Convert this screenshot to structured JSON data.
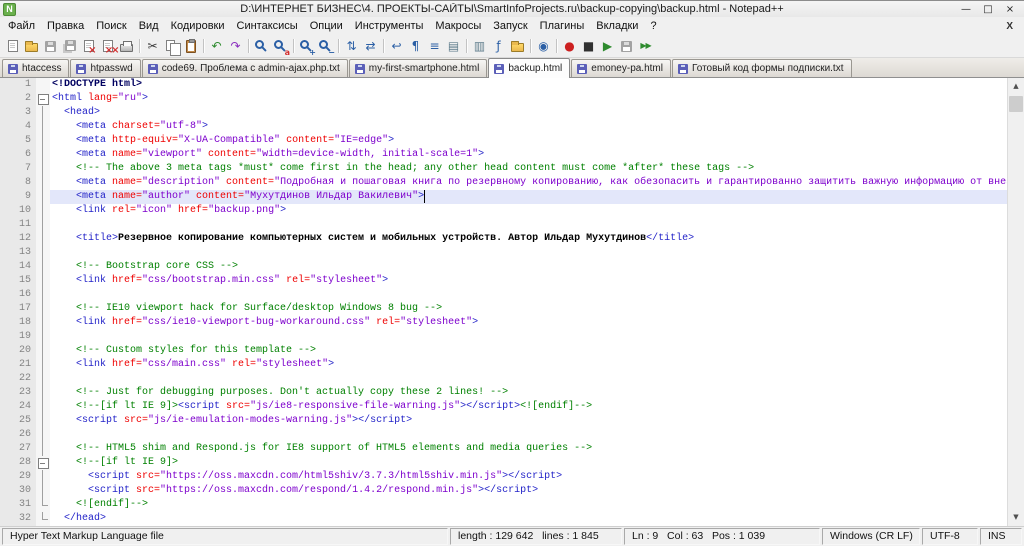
{
  "window": {
    "title": "D:\\ИНТЕРНЕТ БИЗНЕС\\4. ПРОЕКТЫ-САЙТЫ\\SmartInfoProjects.ru\\backup-copying\\backup.html - Notepad++",
    "icon_letter": "N",
    "controls": [
      {
        "name": "minimize-button",
        "glyph": "—"
      },
      {
        "name": "restore-button",
        "glyph": "□"
      },
      {
        "name": "close-button",
        "glyph": "×"
      }
    ]
  },
  "menu": {
    "items": [
      "Файл",
      "Правка",
      "Поиск",
      "Вид",
      "Кодировки",
      "Синтаксисы",
      "Опции",
      "Инструменты",
      "Макросы",
      "Запуск",
      "Плагины",
      "Вкладки",
      "?"
    ],
    "close_label": "X"
  },
  "toolbar": {
    "items": [
      {
        "name": "new-file-icon",
        "type": "sheet"
      },
      {
        "name": "open-file-icon",
        "type": "folder"
      },
      {
        "name": "save-icon",
        "type": "floppy",
        "dim": true
      },
      {
        "name": "save-all-icon",
        "type": "floppy2",
        "dim": true
      },
      {
        "name": "close-icon",
        "type": "sheet-x"
      },
      {
        "name": "close-all-icon",
        "type": "sheet-xx"
      },
      {
        "name": "print-icon",
        "type": "printer"
      },
      {
        "sep": true
      },
      {
        "name": "cut-icon",
        "type": "glyph",
        "glyph": "✂",
        "color": "#3a3a3a"
      },
      {
        "name": "copy-icon",
        "type": "pages"
      },
      {
        "name": "paste-icon",
        "type": "clipboard"
      },
      {
        "sep": true
      },
      {
        "name": "undo-icon",
        "type": "glyph",
        "glyph": "↶",
        "color": "#2e8b2e"
      },
      {
        "name": "redo-icon",
        "type": "glyph",
        "glyph": "↷",
        "color": "#8a2ebe"
      },
      {
        "sep": true
      },
      {
        "name": "find-icon",
        "type": "mag"
      },
      {
        "name": "replace-icon",
        "type": "mag",
        "badge": "a",
        "badge_color": "#d32f2f"
      },
      {
        "sep": true
      },
      {
        "name": "zoom-in-icon",
        "type": "mag",
        "badge": "+",
        "badge_color": "#2b5fa5"
      },
      {
        "name": "zoom-out-icon",
        "type": "mag",
        "badge": "−",
        "badge_color": "#2b5fa5"
      },
      {
        "sep": true
      },
      {
        "name": "sync-vertical-scroll-icon",
        "type": "glyph",
        "glyph": "⇅",
        "color": "#2b5fa5"
      },
      {
        "name": "sync-horizontal-scroll-icon",
        "type": "glyph",
        "glyph": "⇄",
        "color": "#2b5fa5"
      },
      {
        "sep": true
      },
      {
        "name": "word-wrap-icon",
        "type": "glyph",
        "glyph": "↩",
        "color": "#2b5fa5"
      },
      {
        "name": "show-all-characters-icon",
        "type": "glyph",
        "glyph": "¶",
        "color": "#2b5fa5"
      },
      {
        "name": "indent-guide-icon",
        "type": "glyph",
        "glyph": "≡",
        "color": "#2b5fa5"
      },
      {
        "name": "user-defined-dialog-icon",
        "type": "glyph",
        "glyph": "▤",
        "color": "#5f7d8c"
      },
      {
        "sep": true
      },
      {
        "name": "document-map-icon",
        "type": "glyph",
        "glyph": "▥",
        "color": "#5f7d8c"
      },
      {
        "name": "function-list-icon",
        "type": "glyph",
        "glyph": "ƒ",
        "color": "#2b5fa5"
      },
      {
        "name": "folder-as-workspace-icon",
        "type": "folder"
      },
      {
        "sep": true
      },
      {
        "name": "monitoring-icon",
        "type": "glyph",
        "glyph": "◉",
        "color": "#2b5fa5"
      },
      {
        "sep": true
      },
      {
        "name": "record-macro-icon",
        "type": "glyph",
        "glyph": "●",
        "color": "#cc2020"
      },
      {
        "name": "stop-recording-icon",
        "type": "glyph",
        "glyph": "■",
        "color": "#303030"
      },
      {
        "name": "playback-macro-icon",
        "type": "glyph",
        "glyph": "▶",
        "color": "#2e8b2e"
      },
      {
        "name": "save-macro-icon",
        "type": "floppy",
        "dim": true
      },
      {
        "name": "run-macro-multiple-icon",
        "type": "glyph",
        "glyph": "▶▶",
        "color": "#2e8b2e"
      }
    ]
  },
  "tabs": [
    {
      "label": "htaccess",
      "active": false
    },
    {
      "label": "htpasswd",
      "active": false
    },
    {
      "label": "code69. Проблема с admin-ajax.php.txt",
      "active": false
    },
    {
      "label": "my-first-smartphone.html",
      "active": false
    },
    {
      "label": "backup.html",
      "active": true
    },
    {
      "label": "emoney-pa.html",
      "active": false
    },
    {
      "label": "Готовый код формы подписки.txt",
      "active": false
    }
  ],
  "scrollbar": {
    "up": "▲",
    "down": "▼"
  },
  "editor": {
    "caret": {
      "line": 9,
      "col": 63
    },
    "lines": [
      {
        "n": 1,
        "fold": "",
        "hl": false,
        "tokens": [
          [
            "d",
            "<!DOCTYPE html>"
          ]
        ]
      },
      {
        "n": 2,
        "fold": "m",
        "hl": false,
        "tokens": [
          [
            "t",
            "<html "
          ],
          [
            "a",
            "lang="
          ],
          [
            "v",
            "\"ru\""
          ],
          [
            "t",
            ">"
          ]
        ]
      },
      {
        "n": 3,
        "fold": "l",
        "hl": false,
        "tokens": [
          [
            "t",
            "  <head>"
          ]
        ]
      },
      {
        "n": 4,
        "fold": "l",
        "hl": false,
        "tokens": [
          [
            "t",
            "    <meta "
          ],
          [
            "a",
            "charset="
          ],
          [
            "v",
            "\"utf-8\""
          ],
          [
            "t",
            ">"
          ]
        ]
      },
      {
        "n": 5,
        "fold": "l",
        "hl": false,
        "tokens": [
          [
            "t",
            "    <meta "
          ],
          [
            "a",
            "http-equiv="
          ],
          [
            "v",
            "\"X-UA-Compatible\""
          ],
          [
            "a",
            " content="
          ],
          [
            "v",
            "\"IE=edge\""
          ],
          [
            "t",
            ">"
          ]
        ]
      },
      {
        "n": 6,
        "fold": "l",
        "hl": false,
        "tokens": [
          [
            "t",
            "    <meta "
          ],
          [
            "a",
            "name="
          ],
          [
            "v",
            "\"viewport\""
          ],
          [
            "a",
            " content="
          ],
          [
            "v",
            "\"width=device-width, initial-scale=1\""
          ],
          [
            "t",
            ">"
          ]
        ]
      },
      {
        "n": 7,
        "fold": "l",
        "hl": false,
        "tokens": [
          [
            "c",
            "    <!-- The above 3 meta tags *must* come first in the head; any other head content must come *after* these tags -->"
          ]
        ]
      },
      {
        "n": 8,
        "fold": "l",
        "hl": false,
        "tokens": [
          [
            "t",
            "    <meta "
          ],
          [
            "a",
            "name="
          ],
          [
            "v",
            "\"description\""
          ],
          [
            "a",
            " content="
          ],
          [
            "v",
            "\"Подробная и пошаговая книга по резервному копированию, как обезопасить и гарантированно защитить важную информацию от внез"
          ]
        ]
      },
      {
        "n": 9,
        "fold": "l",
        "hl": true,
        "tokens": [
          [
            "t",
            "    <meta "
          ],
          [
            "a",
            "name="
          ],
          [
            "v",
            "\"author\""
          ],
          [
            "a",
            " content="
          ],
          [
            "v",
            "\"Мухутдинов Ильдар Вакилевич\""
          ],
          [
            "t",
            ">"
          ]
        ]
      },
      {
        "n": 10,
        "fold": "l",
        "hl": false,
        "tokens": [
          [
            "t",
            "    <link "
          ],
          [
            "a",
            "rel="
          ],
          [
            "v",
            "\"icon\""
          ],
          [
            "a",
            " href="
          ],
          [
            "v",
            "\"backup.png\""
          ],
          [
            "t",
            ">"
          ]
        ]
      },
      {
        "n": 11,
        "fold": "l",
        "hl": false,
        "tokens": []
      },
      {
        "n": 12,
        "fold": "l",
        "hl": false,
        "tokens": [
          [
            "t",
            "    <title>"
          ],
          [
            "x",
            "Резервное копирование компьютерных систем и мобильных устройств. Автор Ильдар Мухутдинов"
          ],
          [
            "t",
            "</title>"
          ]
        ]
      },
      {
        "n": 13,
        "fold": "l",
        "hl": false,
        "tokens": []
      },
      {
        "n": 14,
        "fold": "l",
        "hl": false,
        "tokens": [
          [
            "c",
            "    <!-- Bootstrap core CSS -->"
          ]
        ]
      },
      {
        "n": 15,
        "fold": "l",
        "hl": false,
        "tokens": [
          [
            "t",
            "    <link "
          ],
          [
            "a",
            "href="
          ],
          [
            "v",
            "\"css/bootstrap.min.css\""
          ],
          [
            "a",
            " rel="
          ],
          [
            "v",
            "\"stylesheet\""
          ],
          [
            "t",
            ">"
          ]
        ]
      },
      {
        "n": 16,
        "fold": "l",
        "hl": false,
        "tokens": []
      },
      {
        "n": 17,
        "fold": "l",
        "hl": false,
        "tokens": [
          [
            "c",
            "    <!-- IE10 viewport hack for Surface/desktop Windows 8 bug -->"
          ]
        ]
      },
      {
        "n": 18,
        "fold": "l",
        "hl": false,
        "tokens": [
          [
            "t",
            "    <link "
          ],
          [
            "a",
            "href="
          ],
          [
            "v",
            "\"css/ie10-viewport-bug-workaround.css\""
          ],
          [
            "a",
            " rel="
          ],
          [
            "v",
            "\"stylesheet\""
          ],
          [
            "t",
            ">"
          ]
        ]
      },
      {
        "n": 19,
        "fold": "l",
        "hl": false,
        "tokens": []
      },
      {
        "n": 20,
        "fold": "l",
        "hl": false,
        "tokens": [
          [
            "c",
            "    <!-- Custom styles for this template -->"
          ]
        ]
      },
      {
        "n": 21,
        "fold": "l",
        "hl": false,
        "tokens": [
          [
            "t",
            "    <link "
          ],
          [
            "a",
            "href="
          ],
          [
            "v",
            "\"css/main.css\""
          ],
          [
            "a",
            " rel="
          ],
          [
            "v",
            "\"stylesheet\""
          ],
          [
            "t",
            ">"
          ]
        ]
      },
      {
        "n": 22,
        "fold": "l",
        "hl": false,
        "tokens": []
      },
      {
        "n": 23,
        "fold": "l",
        "hl": false,
        "tokens": [
          [
            "c",
            "    <!-- Just for debugging purposes. Don't actually copy these 2 lines! -->"
          ]
        ]
      },
      {
        "n": 24,
        "fold": "l",
        "hl": false,
        "tokens": [
          [
            "c",
            "    <!--[if lt IE 9]>"
          ],
          [
            "t",
            "<script "
          ],
          [
            "a",
            "src="
          ],
          [
            "v",
            "\"js/ie8-responsive-file-warning.js\""
          ],
          [
            "t",
            "></script>"
          ],
          [
            "c",
            "<![endif]-->"
          ]
        ]
      },
      {
        "n": 25,
        "fold": "l",
        "hl": false,
        "tokens": [
          [
            "t",
            "    <script "
          ],
          [
            "a",
            "src="
          ],
          [
            "v",
            "\"js/ie-emulation-modes-warning.js\""
          ],
          [
            "t",
            "></script>"
          ]
        ]
      },
      {
        "n": 26,
        "fold": "l",
        "hl": false,
        "tokens": []
      },
      {
        "n": 27,
        "fold": "l",
        "hl": false,
        "tokens": [
          [
            "c",
            "    <!-- HTML5 shim and Respond.js for IE8 support of HTML5 elements and media queries -->"
          ]
        ]
      },
      {
        "n": 28,
        "fold": "m",
        "hl": false,
        "tokens": [
          [
            "c",
            "    <!--[if lt IE 9]>"
          ]
        ]
      },
      {
        "n": 29,
        "fold": "l",
        "hl": false,
        "tokens": [
          [
            "t",
            "      <script "
          ],
          [
            "a",
            "src="
          ],
          [
            "v",
            "\"https://oss.maxcdn.com/html5shiv/3.7.3/html5shiv.min.js\""
          ],
          [
            "t",
            "></script>"
          ]
        ]
      },
      {
        "n": 30,
        "fold": "l",
        "hl": false,
        "tokens": [
          [
            "t",
            "      <script "
          ],
          [
            "a",
            "src="
          ],
          [
            "v",
            "\"https://oss.maxcdn.com/respond/1.4.2/respond.min.js\""
          ],
          [
            "t",
            "></script>"
          ]
        ]
      },
      {
        "n": 31,
        "fold": "e",
        "hl": false,
        "tokens": [
          [
            "c",
            "    <![endif]-->"
          ]
        ]
      },
      {
        "n": 32,
        "fold": "e",
        "hl": false,
        "tokens": [
          [
            "t",
            "  </head>"
          ]
        ]
      }
    ]
  },
  "status_bar": {
    "sections": [
      {
        "name": "doc-type-panel",
        "text": "Hyper Text Markup Language file",
        "flex": true
      },
      {
        "name": "doc-length-panel",
        "text": "length : 129 642   lines : 1 845"
      },
      {
        "name": "cursor-position-panel",
        "text": "Ln : 9   Col : 63   Pos : 1 039"
      },
      {
        "name": "eol-format-panel",
        "text": "Windows (CR LF)"
      },
      {
        "name": "encoding-panel",
        "text": "UTF-8"
      },
      {
        "name": "insert-mode-panel",
        "text": "INS"
      }
    ]
  }
}
